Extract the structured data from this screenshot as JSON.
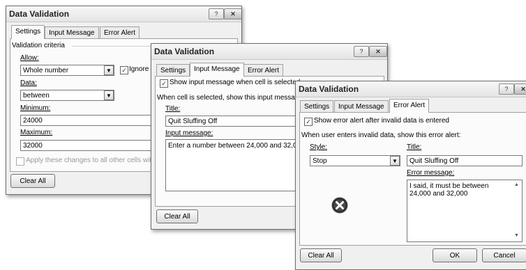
{
  "dialog1": {
    "title": "Data Validation",
    "help": "?",
    "close": "✕",
    "tabs": [
      "Settings",
      "Input Message",
      "Error Alert"
    ],
    "criteria_label": "Validation criteria",
    "allow_label": "Allow:",
    "allow_value": "Whole number",
    "ignore_blank": "Ignore b",
    "data_label": "Data:",
    "data_value": "between",
    "minimum_label": "Minimum:",
    "minimum_value": "24000",
    "maximum_label": "Maximum:",
    "maximum_value": "32000",
    "apply_label": "Apply these changes to all other cells with t",
    "clear_all": "Clear All"
  },
  "dialog2": {
    "title": "Data Validation",
    "help": "?",
    "close": "✕",
    "tabs": [
      "Settings",
      "Input Message",
      "Error Alert"
    ],
    "show_label": "Show input message when cell is selected",
    "when_label": "When cell is selected, show this input message",
    "title_label": "Title:",
    "title_value": "Quit Sluffing Off",
    "message_label": "Input message:",
    "message_value": "Enter a number between 24,000 and 32,000",
    "clear_all": "Clear All"
  },
  "dialog3": {
    "title": "Data Validation",
    "help": "?",
    "close": "✕",
    "tabs": [
      "Settings",
      "Input Message",
      "Error Alert"
    ],
    "show_label": "Show error alert after invalid data is entered",
    "when_label": "When user enters invalid data, show this error alert:",
    "style_label": "Style:",
    "style_value": "Stop",
    "title_label": "Title:",
    "title_value": "Quit Sluffing Off",
    "error_label": "Error message:",
    "error_value": "I said, it must be between 24,000 and 32,000",
    "clear_all": "Clear All",
    "ok": "OK",
    "cancel": "Cancel"
  }
}
